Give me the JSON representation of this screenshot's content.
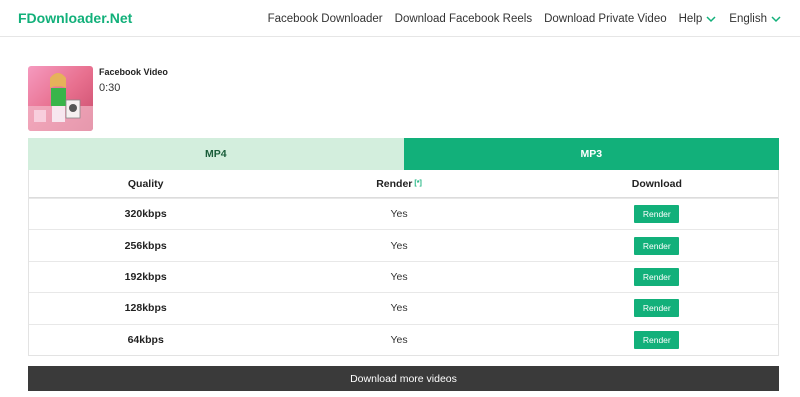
{
  "header": {
    "logo": "FDownloader.Net",
    "nav": [
      {
        "label": "Facebook Downloader"
      },
      {
        "label": "Download Facebook Reels"
      },
      {
        "label": "Download Private Video"
      },
      {
        "label": "Help"
      },
      {
        "label": "English"
      }
    ]
  },
  "video": {
    "title": "Facebook Video",
    "duration": "0:30"
  },
  "tabs": [
    {
      "label": "MP4",
      "active": false
    },
    {
      "label": "MP3",
      "active": true
    }
  ],
  "table": {
    "headers": {
      "quality": "Quality",
      "render": "Render",
      "render_note": "[*]",
      "download": "Download"
    },
    "rows": [
      {
        "quality": "320kbps",
        "render": "Yes",
        "action": "Render"
      },
      {
        "quality": "256kbps",
        "render": "Yes",
        "action": "Render"
      },
      {
        "quality": "192kbps",
        "render": "Yes",
        "action": "Render"
      },
      {
        "quality": "128kbps",
        "render": "Yes",
        "action": "Render"
      },
      {
        "quality": "64kbps",
        "render": "Yes",
        "action": "Render"
      }
    ]
  },
  "more_button": "Download more videos",
  "colors": {
    "accent": "#12b07a",
    "tab_inactive_bg": "#d3eedd",
    "bottom_bar": "#3a3a3a"
  }
}
